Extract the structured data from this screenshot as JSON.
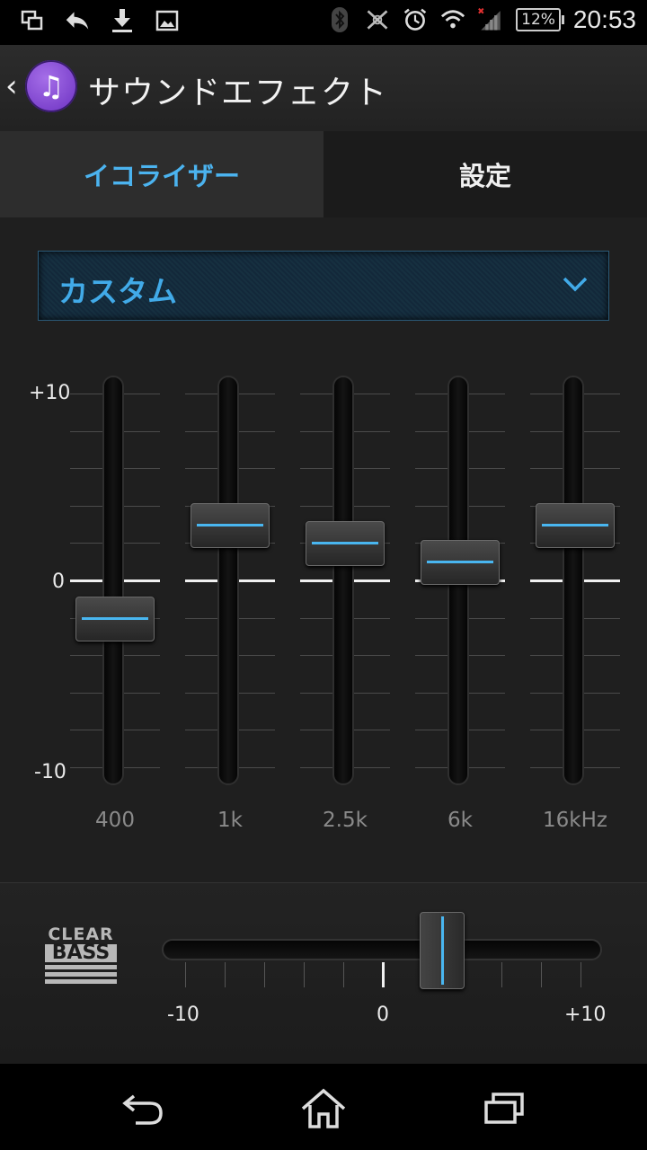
{
  "status_bar": {
    "left_icons": [
      "recent-apps-small-icon",
      "reply-icon",
      "download-icon",
      "image-icon"
    ],
    "right_icons": [
      "bluetooth-icon",
      "nfc-off-icon",
      "alarm-icon",
      "wifi-icon",
      "signal-no-service-icon"
    ],
    "battery": "12%",
    "time": "20:53"
  },
  "action_bar": {
    "app_icon": "music-note-icon",
    "title": "サウンドエフェクト"
  },
  "tabs": [
    {
      "label": "イコライザー",
      "active": true
    },
    {
      "label": "設定",
      "active": false
    }
  ],
  "equalizer": {
    "preset": "カスタム",
    "scale": {
      "max_label": "+10",
      "zero_label": "0",
      "min_label": "-10",
      "max": 10,
      "min": -10
    },
    "bands": [
      {
        "label": "400",
        "value": -2
      },
      {
        "label": "1k",
        "value": 3
      },
      {
        "label": "2.5k",
        "value": 2
      },
      {
        "label": "6k",
        "value": 1
      },
      {
        "label": "16kHz",
        "value": 3
      }
    ]
  },
  "clear_bass": {
    "logo_top": "CLEAR",
    "logo_main": "BASS",
    "min_label": "-10",
    "zero_label": "0",
    "max_label": "+10",
    "min": -10,
    "max": 10,
    "value": 3
  },
  "nav_bar": {
    "buttons": [
      "back-icon",
      "home-icon",
      "recent-apps-icon"
    ]
  },
  "colors": {
    "accent": "#49b6f0",
    "tab_active_text": "#4bb3ef",
    "preset_text": "#41aae8"
  }
}
